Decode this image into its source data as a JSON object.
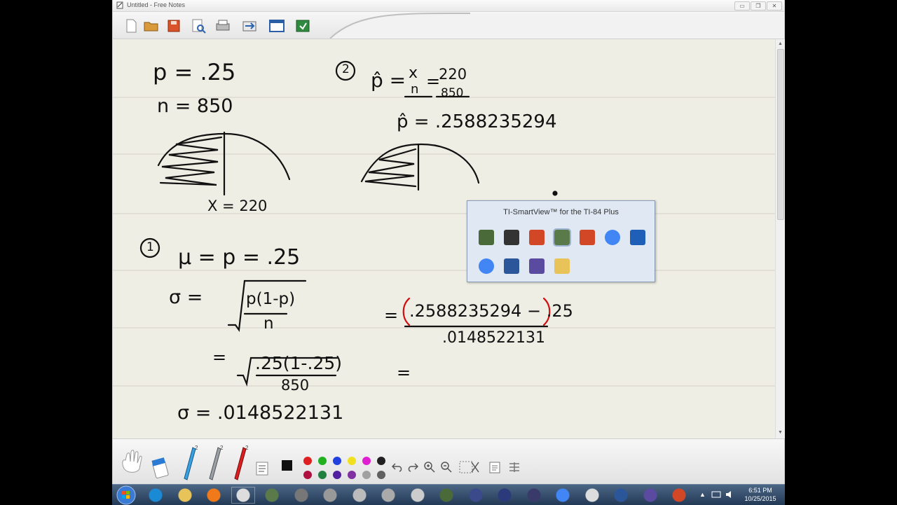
{
  "window": {
    "title": "Untitled - Free Notes",
    "minimize": "▭",
    "maximize": "❐",
    "close": "✕"
  },
  "toolbar": {
    "buttons": [
      "new-icon",
      "open-folder-icon",
      "save-icon",
      "print-preview-icon",
      "print-icon",
      "share-icon",
      "fullscreen-icon",
      "export-icon"
    ]
  },
  "notes": {
    "p_value": "p = .25",
    "n_value": "n = 850",
    "x_value": "X = 220",
    "step1_label": "1",
    "mu_line": "μ = p = .25",
    "sigma_line": "σ =",
    "sigma_frac_num": "p(1-p)",
    "sigma_frac_den": "n",
    "sub_line_eq": "=",
    "sub_num": ".25(1-.25)",
    "sub_den": "850",
    "sigma_result": "σ = .0148522131",
    "step2_label": "2",
    "phat_line": "p̂ =",
    "phat_frac_num": "x",
    "phat_frac_den": "n",
    "phat_eq2": "=",
    "phat_frac2_num": "220",
    "phat_frac2_den": "850",
    "phat_result": "p̂ = .2588235294",
    "z_eq1": "=",
    "z_num": ".2588235294 − .25",
    "z_den": ".0148522131",
    "z_eq2": "="
  },
  "popup": {
    "title": "TI-SmartView™ for the TI-84 Plus",
    "row1": [
      "ti-calculator-icon",
      "pen-tool-icon",
      "powerpoint-icon",
      "ti-smartview-icon",
      "powerpoint-icon",
      "chrome-icon",
      "desktop-icon"
    ],
    "row2": [
      "chrome-icon",
      "word-icon",
      "calendar-app-icon",
      "folder-icon"
    ]
  },
  "bottombar": {
    "pen_sizes": [
      "2",
      "2",
      "2"
    ],
    "colors_row1": [
      "#e02020",
      "#20b020",
      "#2040e0",
      "#f0e020",
      "#e020d0",
      "#202020"
    ],
    "colors_row2": [
      "#b01040",
      "#208040",
      "#5020a0",
      "#8030a0",
      "#a0a0a0",
      "#606060"
    ]
  },
  "taskbar": {
    "time": "6:51 PM",
    "date": "10/25/2015"
  }
}
